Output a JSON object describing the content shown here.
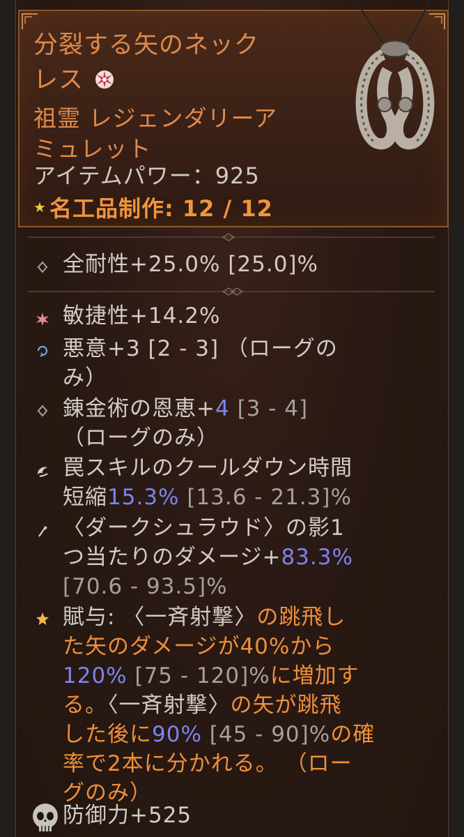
{
  "item": {
    "name_line1": "分裂する矢のネック",
    "name_line2": "レス",
    "type_line1": "祖霊 レジェンダリーア",
    "type_line2": "ミュレット",
    "item_power": "アイテムパワー：925",
    "masterwork": "名工品制作: 12 / 12"
  },
  "implicit": {
    "all_resist": "全耐性+25.0% [25.0]%"
  },
  "affixes": {
    "dex": "敏捷性+14.2%",
    "malice_a": "悪意+3 [2 - 3] （ローグの",
    "malice_b": "み）",
    "alch_a": "錬金術の恩恵+",
    "alch_val": "4",
    "alch_range": " [3 - 4]",
    "alch_b": "（ローグのみ）",
    "trap_a": "罠スキルのクールダウン時間",
    "trap_b": "短縮",
    "trap_val": "15.3%",
    "trap_range": " [13.6 - 21.3]%",
    "shroud_a": "〈ダークシュラウド〉の影1",
    "shroud_b": "つ当たりのダメージ+",
    "shroud_val": "83.3%",
    "shroud_range": "[70.6 - 93.5]%"
  },
  "aspect": {
    "l1_white": "賦与: 〈一斉射撃〉",
    "l1_orange": "の跳飛し",
    "l2": "た矢のダメージが40%から",
    "l3_val": "120%",
    "l3_range": " [75 - 120]%",
    "l3_orange": "に増加す",
    "l4_orange": "る。",
    "l4_white": "〈一斉射撃〉",
    "l4_orange2": "の矢が跳飛",
    "l5_orange": "した後に",
    "l5_val": "90%",
    "l5_range": " [45 - 90]%",
    "l5_orange2": "の確",
    "l6": "率で2本に分かれる。 （ロー",
    "l7": "グのみ）"
  },
  "armor": {
    "defense": "防御力+525"
  },
  "colors": {
    "title_orange": "#e0894a",
    "value_blue": "#7c84ef",
    "range_gray": "#a5a09a",
    "aspect_orange": "#ef8f3a"
  },
  "icons": [
    "rarity-star-icon",
    "amulet-image",
    "masterwork-star-icon",
    "diamond-bullet-icon",
    "dexterity-icon",
    "malice-icon",
    "trap-icon",
    "shroud-icon",
    "aspect-star-icon",
    "armor-skull-icon"
  ]
}
